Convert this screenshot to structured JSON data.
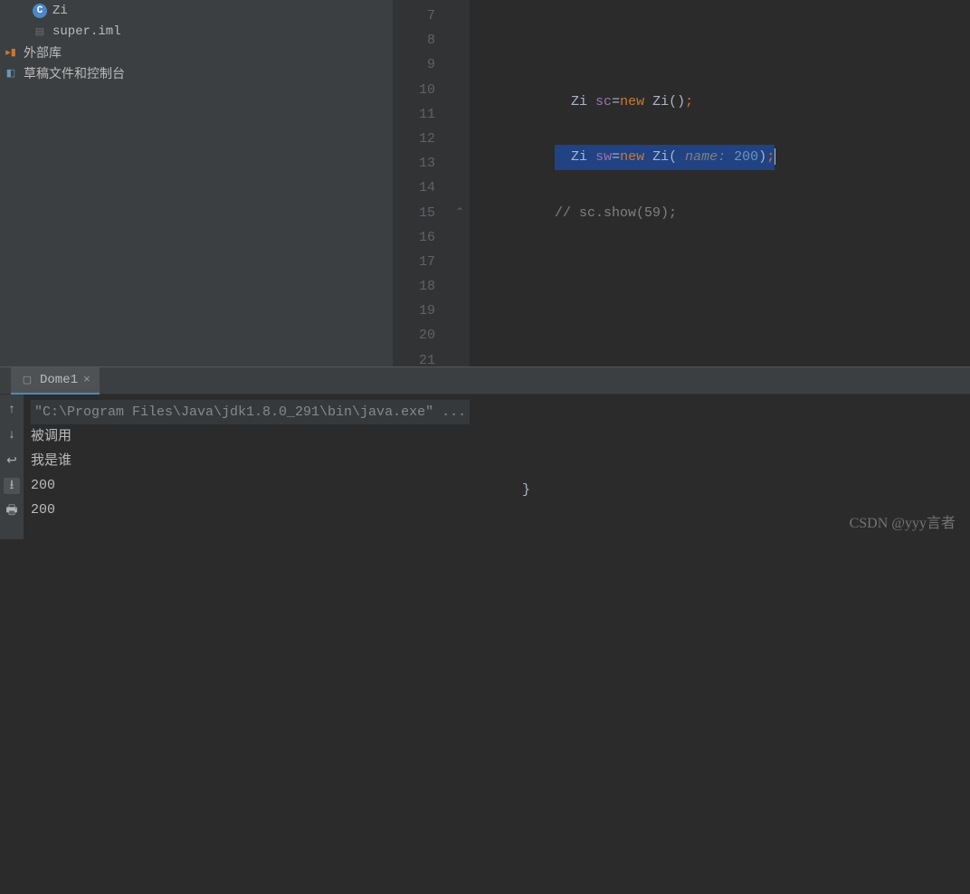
{
  "sidebar": {
    "items": [
      {
        "icon": "C",
        "label": "Zi"
      },
      {
        "icon": "F",
        "label": "super.iml"
      },
      {
        "icon": "L",
        "label": "外部库"
      },
      {
        "icon": "S",
        "label": "草稿文件和控制台"
      }
    ]
  },
  "gutter": {
    "start": 7,
    "end": 21
  },
  "code": {
    "line7": "",
    "line8": {
      "type": "Zi",
      "var": "sc",
      "kw": "new",
      "call": "Zi()",
      ";": ";"
    },
    "line9": {
      "type": "Zi",
      "var": "sw",
      "kw": "new",
      "call": "Zi(",
      "param": " name: ",
      "arg": "200",
      ")": ")",
      ";": ";"
    },
    "line10": "// sc.show(59);",
    "line15": "}"
  },
  "run": {
    "tab": "Dome1",
    "cmd": "\"C:\\Program Files\\Java\\jdk1.8.0_291\\bin\\java.exe\" ...",
    "out": [
      "被调用",
      "我是谁",
      "200",
      "200"
    ]
  },
  "watermark": "CSDN @yyy言者"
}
